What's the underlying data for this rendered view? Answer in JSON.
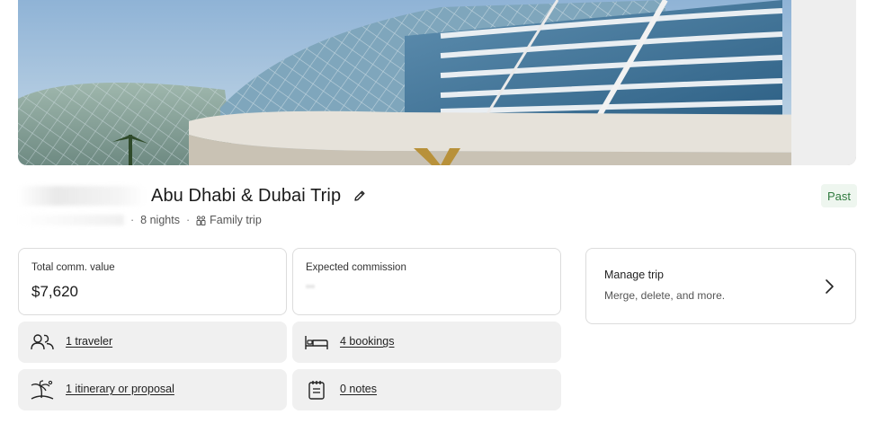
{
  "trip": {
    "title": "Abu Dhabi & Dubai Trip",
    "status": "Past",
    "nights": "8 nights",
    "trip_type": "Family trip"
  },
  "stats": {
    "total_label": "Total comm. value",
    "total_value": "$7,620",
    "expected_label": "Expected commission"
  },
  "links": {
    "travelers": "1 traveler",
    "bookings": "4 bookings",
    "itinerary": "1 itinerary or proposal",
    "notes": "0 notes"
  },
  "manage": {
    "title": "Manage trip",
    "subtitle": "Merge, delete, and more."
  },
  "icons": {
    "edit": "pencil-icon",
    "travelers": "people-icon",
    "bookings": "bed-icon",
    "itinerary": "palm-tree-icon",
    "notes": "notepad-icon",
    "trip_type": "family-icon",
    "manage": "chevron-right-icon"
  },
  "colors": {
    "status_bg": "#eef6ef",
    "status_text": "#2f7a3e",
    "card_border": "#dcdcdc",
    "link_card_bg": "#f0f0f0"
  }
}
